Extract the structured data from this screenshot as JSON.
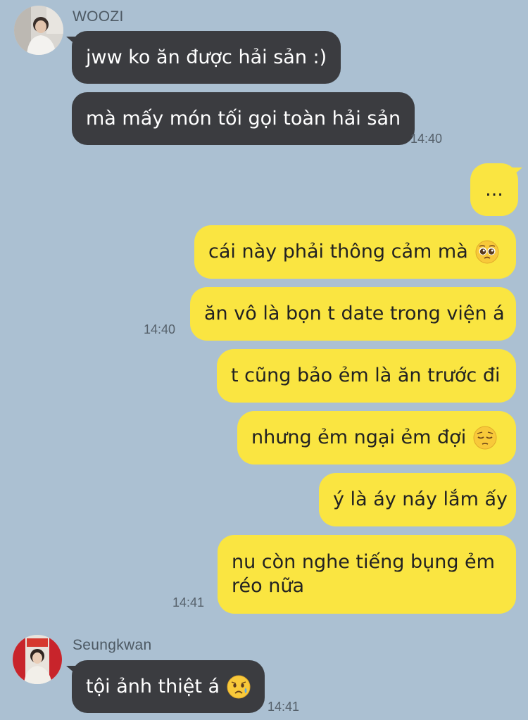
{
  "conversation": {
    "groups": [
      {
        "sender": "WOOZI",
        "avatar": "woozi-avatar",
        "messages": [
          "jww ko ăn được hải sản :)",
          "mà mấy món tối gọi toàn hải sản"
        ],
        "time": "14:40"
      },
      {
        "sender": "me",
        "messages": [
          "...",
          "cái này phải thông cảm mà",
          "ăn vô là bọn t date trong viện á"
        ],
        "time": "14:40"
      },
      {
        "sender": "me",
        "messages": [
          "t cũng bảo ẻm là ăn trước đi",
          "nhưng ẻm ngại ẻm đợi",
          "ý là áy náy lắm ấy",
          "nu còn nghe tiếng bụng ẻm réo nữa"
        ],
        "time": "14:41"
      },
      {
        "sender": "Seungkwan",
        "avatar": "seungkwan-avatar",
        "messages": [
          "tội ảnh thiệt á"
        ],
        "time": "14:41"
      }
    ],
    "emoji": {
      "pleading": "pleading-face-emoji",
      "pensive": "pensive-face-emoji",
      "sad_sweat": "sad-but-relieved-face-emoji"
    }
  },
  "colors": {
    "background": "#abc0d2",
    "incoming_bubble": "#3b3c40",
    "outgoing_bubble": "#fae541"
  }
}
